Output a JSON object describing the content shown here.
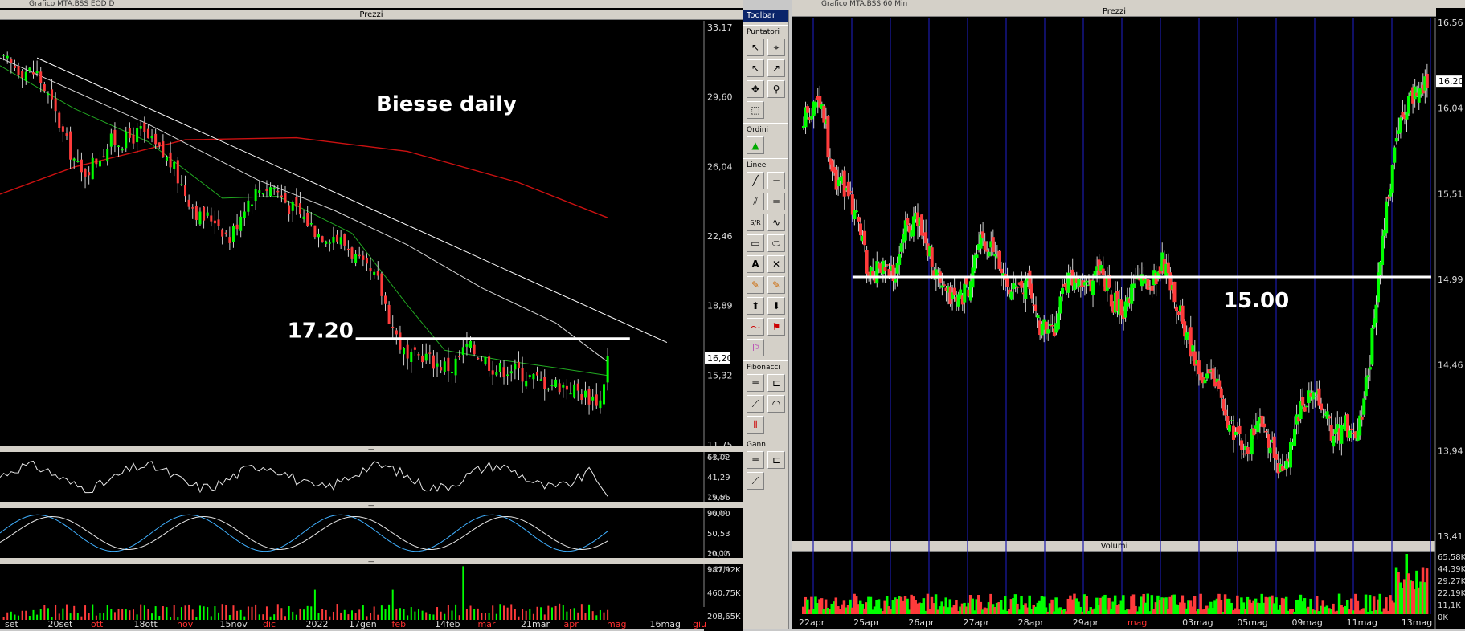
{
  "left_window": {
    "title": "Grafico MTA.BSS EOD D",
    "prices_panel_label": "Prezzi",
    "annotation_title": "Biesse daily",
    "support_label": "17.20"
  },
  "right_window": {
    "title": "Grafico MTA.BSS 60 Min",
    "prices_panel_label": "Prezzi",
    "volume_panel_label": "Volumi",
    "support_label": "15.00"
  },
  "toolbar": {
    "title": "Toolbar",
    "sections": [
      "Puntatori",
      "Ordini",
      "Linee",
      "Fibonacci",
      "Gann"
    ]
  },
  "colors": {
    "background": "#000000",
    "candle_up": "#00ff00",
    "candle_down": "#ff3b3b",
    "ma_slow": "#cc1111",
    "ma_fast": "#22aa22",
    "ma_mid": "#d8d8d8",
    "oscillator": "#40b0ff",
    "session_line": "#1a1aaa"
  },
  "chart_data": [
    {
      "type": "candlestick",
      "title": "Biesse daily",
      "ylim": [
        11.75,
        33.17
      ],
      "y_ticks": [
        "33,17",
        "29,60",
        "26,04",
        "22,46",
        "18,89",
        "15,32",
        "11,75"
      ],
      "last_price": "16,20",
      "x_ticks": [
        {
          "label": "set",
          "red": false
        },
        {
          "label": "20set",
          "red": false
        },
        {
          "label": "ott",
          "red": true
        },
        {
          "label": "18ott",
          "red": false
        },
        {
          "label": "nov",
          "red": true
        },
        {
          "label": "15nov",
          "red": false
        },
        {
          "label": "dic",
          "red": true
        },
        {
          "label": "2022",
          "red": false
        },
        {
          "label": "17gen",
          "red": false
        },
        {
          "label": "feb",
          "red": true
        },
        {
          "label": "14feb",
          "red": false
        },
        {
          "label": "mar",
          "red": true
        },
        {
          "label": "21mar",
          "red": false
        },
        {
          "label": "apr",
          "red": true
        },
        {
          "label": "mag",
          "red": true
        },
        {
          "label": "16mag",
          "red": false
        },
        {
          "label": "giu",
          "red": true
        }
      ],
      "close_path": [
        [
          0,
          31.5
        ],
        [
          6,
          31.0
        ],
        [
          10,
          30.8
        ],
        [
          14,
          29.2
        ],
        [
          18,
          27.2
        ],
        [
          22,
          25.6
        ],
        [
          26,
          26.4
        ],
        [
          30,
          27.3
        ],
        [
          34,
          27.4
        ],
        [
          38,
          27.8
        ],
        [
          42,
          27.0
        ],
        [
          46,
          26.2
        ],
        [
          50,
          24.7
        ],
        [
          54,
          23.4
        ],
        [
          58,
          23.4
        ],
        [
          62,
          22.3
        ],
        [
          66,
          24.1
        ],
        [
          70,
          24.9
        ],
        [
          74,
          25.0
        ],
        [
          78,
          24.0
        ],
        [
          82,
          23.4
        ],
        [
          86,
          22.6
        ],
        [
          90,
          22.5
        ],
        [
          94,
          21.9
        ],
        [
          98,
          20.8
        ],
        [
          102,
          20.1
        ],
        [
          106,
          17.8
        ],
        [
          110,
          16.0
        ],
        [
          114,
          16.4
        ],
        [
          118,
          15.9
        ],
        [
          122,
          15.7
        ],
        [
          126,
          16.8
        ],
        [
          130,
          16.3
        ],
        [
          134,
          15.6
        ],
        [
          138,
          15.7
        ],
        [
          142,
          15.3
        ],
        [
          146,
          15.0
        ],
        [
          150,
          14.9
        ],
        [
          154,
          14.7
        ],
        [
          158,
          14.3
        ],
        [
          162,
          14.0
        ],
        [
          164,
          16.2
        ]
      ],
      "series": [
        {
          "name": "",
          "path": [
            [
              0,
              24.6
            ],
            [
              20,
              26.0
            ],
            [
              50,
              27.4
            ],
            [
              80,
              27.5
            ],
            [
              110,
              26.8
            ],
            [
              140,
              25.2
            ],
            [
              164,
              23.4
            ]
          ]
        },
        {
          "name": "",
          "path": [
            [
              0,
              31.2
            ],
            [
              20,
              29.0
            ],
            [
              40,
              27.3
            ],
            [
              60,
              24.4
            ],
            [
              75,
              24.5
            ],
            [
              95,
              22.6
            ],
            [
              110,
              18.9
            ],
            [
              120,
              16.6
            ],
            [
              135,
              16.1
            ],
            [
              150,
              15.7
            ],
            [
              164,
              15.3
            ]
          ]
        },
        {
          "name": "",
          "path": [
            [
              0,
              31.6
            ],
            [
              40,
              28.2
            ],
            [
              70,
              25.3
            ],
            [
              90,
              23.8
            ],
            [
              110,
              22.0
            ],
            [
              130,
              19.8
            ],
            [
              150,
              18.0
            ],
            [
              164,
              16.0
            ]
          ]
        }
      ],
      "trendline": [
        [
          10,
          31.6
        ],
        [
          180,
          17.0
        ]
      ],
      "support": {
        "value": 17.2,
        "label": "17.20",
        "x_range": [
          96,
          170
        ]
      },
      "subpanels": [
        {
          "type": "line",
          "y_ticks": [
            "63,02",
            "41,29",
            "19,56"
          ],
          "extra_ticks": [
            "54,16",
            "25,46"
          ]
        },
        {
          "type": "line",
          "y_ticks": [
            "90,00",
            "50,53",
            "20,16"
          ],
          "extra_ticks": [
            "96,09",
            "10,00"
          ]
        },
        {
          "type": "bar",
          "y_ticks": [
            "987,92K",
            "460,75K",
            "208,65K"
          ],
          "extra_ticks": [
            "1,27M"
          ]
        }
      ]
    },
    {
      "type": "candlestick",
      "ylim": [
        13.41,
        16.56
      ],
      "y_ticks": [
        "16,56",
        "16,04",
        "15,51",
        "14,99",
        "14,46",
        "13,94",
        "13,41"
      ],
      "last_price": "16,20",
      "x_ticks": [
        {
          "label": "22apr",
          "red": false
        },
        {
          "label": "25apr",
          "red": false
        },
        {
          "label": "26apr",
          "red": false
        },
        {
          "label": "27apr",
          "red": false
        },
        {
          "label": "28apr",
          "red": false
        },
        {
          "label": "29apr",
          "red": false
        },
        {
          "label": "mag",
          "red": true
        },
        {
          "label": "03mag",
          "red": false
        },
        {
          "label": "05mag",
          "red": false
        },
        {
          "label": "09mag",
          "red": false
        },
        {
          "label": "11mag",
          "red": false
        },
        {
          "label": "13mag",
          "red": false
        }
      ],
      "close_path": [
        [
          0,
          15.95
        ],
        [
          3,
          16.1
        ],
        [
          5,
          16.0
        ],
        [
          7,
          15.6
        ],
        [
          10,
          15.55
        ],
        [
          13,
          15.4
        ],
        [
          16,
          15.0
        ],
        [
          19,
          15.05
        ],
        [
          22,
          15.0
        ],
        [
          25,
          15.3
        ],
        [
          28,
          15.35
        ],
        [
          31,
          15.15
        ],
        [
          34,
          14.9
        ],
        [
          37,
          14.85
        ],
        [
          40,
          14.9
        ],
        [
          43,
          15.2
        ],
        [
          46,
          15.15
        ],
        [
          49,
          15.0
        ],
        [
          52,
          14.9
        ],
        [
          55,
          14.95
        ],
        [
          58,
          14.7
        ],
        [
          61,
          14.65
        ],
        [
          64,
          14.95
        ],
        [
          67,
          15.0
        ],
        [
          70,
          14.95
        ],
        [
          73,
          15.05
        ],
        [
          76,
          14.85
        ],
        [
          79,
          14.8
        ],
        [
          82,
          15.0
        ],
        [
          85,
          14.95
        ],
        [
          88,
          15.1
        ],
        [
          91,
          14.9
        ],
        [
          94,
          14.65
        ],
        [
          97,
          14.4
        ],
        [
          100,
          14.45
        ],
        [
          103,
          14.2
        ],
        [
          106,
          14.0
        ],
        [
          109,
          13.95
        ],
        [
          112,
          14.1
        ],
        [
          115,
          13.95
        ],
        [
          118,
          13.78
        ],
        [
          121,
          14.1
        ],
        [
          124,
          14.3
        ],
        [
          127,
          14.25
        ],
        [
          130,
          14.0
        ],
        [
          133,
          14.1
        ],
        [
          136,
          14.0
        ],
        [
          139,
          14.5
        ],
        [
          142,
          15.2
        ],
        [
          145,
          15.8
        ],
        [
          148,
          16.05
        ],
        [
          151,
          16.15
        ],
        [
          153,
          16.2
        ]
      ],
      "support": {
        "value": 15.0,
        "label": "15.00",
        "x_range": [
          12,
          154
        ]
      },
      "volume_y_ticks": [
        "65,58K",
        "44,39K",
        "29,27K",
        "22,19K",
        "11,1K",
        "0K"
      ]
    }
  ]
}
